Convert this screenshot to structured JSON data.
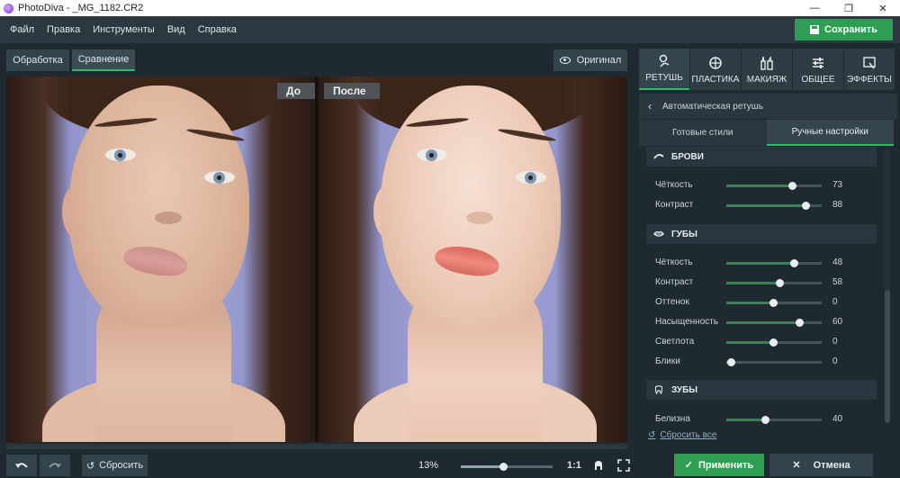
{
  "window": {
    "title": "PhotoDiva - _MG_1182.CR2",
    "controls": [
      "—",
      "❐",
      "✕"
    ]
  },
  "menu": [
    "Файл",
    "Правка",
    "Инструменты",
    "Вид",
    "Справка"
  ],
  "save_label": "Сохранить",
  "view_tabs": [
    {
      "label": "Обработка",
      "active": false
    },
    {
      "label": "Сравнение",
      "active": true
    }
  ],
  "original_label": "Оригинал",
  "compare": {
    "before_label": "До",
    "after_label": "После"
  },
  "bottom": {
    "reset_label": "Сбросить",
    "zoom_percent": "13%",
    "zoom_fraction": 0.46,
    "ratio_label": "1:1"
  },
  "right_tabs": [
    {
      "label": "РЕТУШЬ",
      "icon": "retouch-icon",
      "active": true
    },
    {
      "label": "ПЛАСТИКА",
      "icon": "plastic-icon",
      "active": false
    },
    {
      "label": "МАКИЯЖ",
      "icon": "makeup-icon",
      "active": false
    },
    {
      "label": "ОБЩЕЕ",
      "icon": "sliders-icon",
      "active": false
    },
    {
      "label": "ЭФФЕКТЫ",
      "icon": "effects-icon",
      "active": false
    }
  ],
  "breadcrumb": "Автоматическая ретушь",
  "sub_tabs": [
    {
      "label": "Готовые стили",
      "active": false
    },
    {
      "label": "Ручные настройки",
      "active": true
    }
  ],
  "sections": {
    "brows": {
      "title": "БРОВИ",
      "sliders": [
        {
          "label": "Чёткость",
          "value": "73",
          "fraction": 0.69
        },
        {
          "label": "Контраст",
          "value": "88",
          "fraction": 0.83
        }
      ]
    },
    "lips": {
      "title": "ГУБЫ",
      "sliders": [
        {
          "label": "Чёткость",
          "value": "48",
          "fraction": 0.71
        },
        {
          "label": "Контраст",
          "value": "58",
          "fraction": 0.56
        },
        {
          "label": "Оттенок",
          "value": "0",
          "fraction": 0.49
        },
        {
          "label": "Насыщенность",
          "value": "60",
          "fraction": 0.76
        },
        {
          "label": "Светлота",
          "value": "0",
          "fraction": 0.49
        },
        {
          "label": "Блики",
          "value": "0",
          "fraction": 0.05
        }
      ]
    },
    "teeth": {
      "title": "ЗУБЫ",
      "sliders": [
        {
          "label": "Белизна",
          "value": "40",
          "fraction": 0.41
        }
      ]
    }
  },
  "reset_all_label": "Сбросить все",
  "apply_label": "Применить",
  "cancel_label": "Отмена",
  "colors": {
    "accent": "#2e9e55",
    "panel": "#1f2a30",
    "menubar": "#2b3840"
  }
}
